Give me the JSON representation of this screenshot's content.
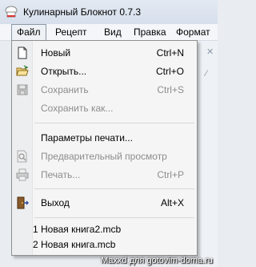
{
  "window": {
    "title": "Кулинарный Блокнот 0.7.3",
    "icon": "app-icon-chef-hat"
  },
  "menubar": {
    "items": [
      {
        "label": "Файл",
        "active": true
      },
      {
        "label": "Рецепт"
      },
      {
        "label": "Вид"
      },
      {
        "label": "Правка"
      },
      {
        "label": "Формат"
      }
    ]
  },
  "file_menu": {
    "items": [
      {
        "label": "Новый",
        "shortcut": "Ctrl+N",
        "icon": "new-document-icon",
        "enabled": true
      },
      {
        "label": "Открыть...",
        "shortcut": "Ctrl+O",
        "icon": "open-folder-icon",
        "enabled": true
      },
      {
        "label": "Сохранить",
        "shortcut": "Ctrl+S",
        "icon": "save-disk-icon",
        "enabled": false
      },
      {
        "label": "Сохранить как...",
        "shortcut": "",
        "icon": "",
        "enabled": false
      },
      {
        "label": "Параметры печати...",
        "shortcut": "",
        "icon": "",
        "enabled": true
      },
      {
        "label": "Предварительный просмотр",
        "shortcut": "",
        "icon": "print-preview-icon",
        "enabled": false
      },
      {
        "label": "Печать...",
        "shortcut": "Ctrl+P",
        "icon": "printer-icon",
        "enabled": false
      },
      {
        "label": "Выход",
        "shortcut": "Alt+X",
        "icon": "exit-door-icon",
        "enabled": true
      }
    ],
    "recent_files": [
      {
        "label": "1 Новая книга2.mcb"
      },
      {
        "label": "2 Новая книга.mcb"
      }
    ]
  },
  "watermark": "Maxxd для gotovim-doma.ru",
  "colors": {
    "disabled_text": "#8d8d8d",
    "menu_bg": "#f5f5f5",
    "menu_border": "#8f8f8f"
  }
}
